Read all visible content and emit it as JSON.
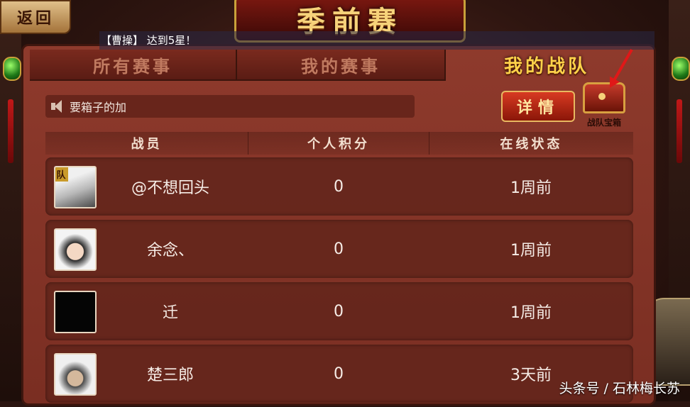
{
  "header": {
    "back_label": "返回",
    "title": "季前赛"
  },
  "marquee": {
    "text": "【曹操】 达到5星！"
  },
  "tabs": [
    {
      "label": "所有赛事",
      "active": false
    },
    {
      "label": "我的赛事",
      "active": false
    },
    {
      "label": "我的战队",
      "active": true
    }
  ],
  "team": {
    "announcement": "要箱子的加",
    "details_label": "详情",
    "chest_label": "战队宝箱"
  },
  "table": {
    "columns": [
      "战员",
      "个人积分",
      "在线状态"
    ],
    "rows": [
      {
        "name": "@不想回头",
        "score": "0",
        "status": "1周前",
        "captain": true,
        "badge": "队"
      },
      {
        "name": "余念、",
        "score": "0",
        "status": "1周前",
        "captain": false
      },
      {
        "name": "迁",
        "score": "0",
        "status": "1周前",
        "captain": false
      },
      {
        "name": "楚三郎",
        "score": "0",
        "status": "3天前",
        "captain": false
      }
    ]
  },
  "watermark": "头条号 / 石林梅长苏",
  "colors": {
    "panel": "#8e3a2c",
    "active_tab_text": "#ffd24a",
    "details_button": "#d83a22",
    "annotation_arrow": "#e01818"
  }
}
